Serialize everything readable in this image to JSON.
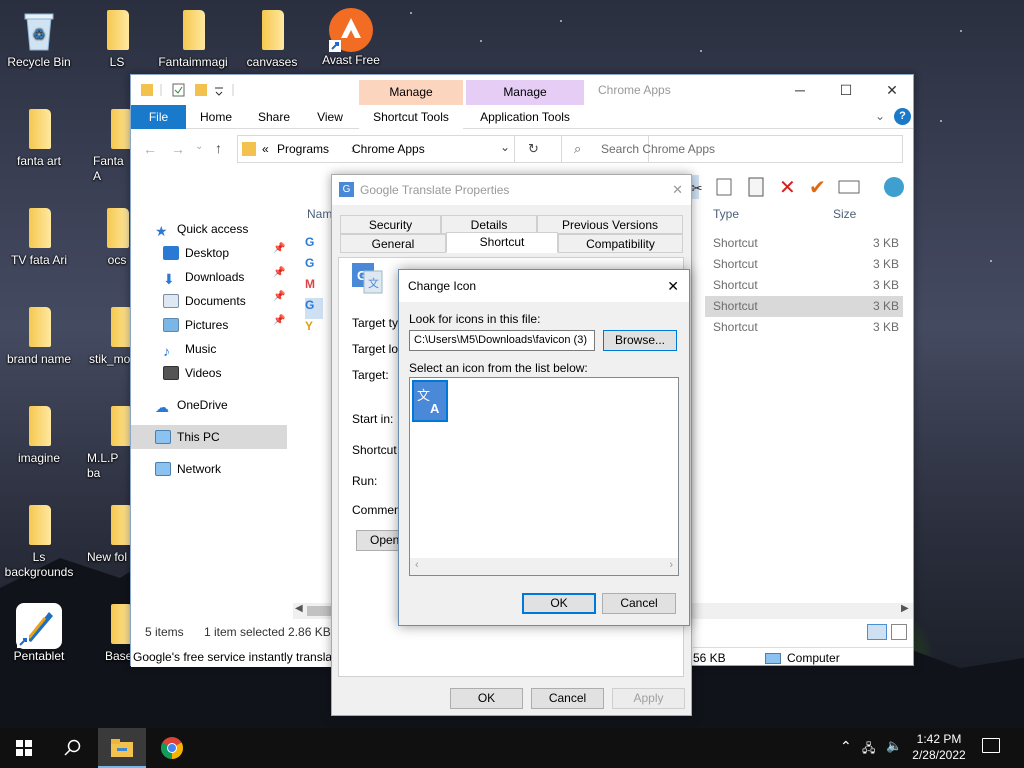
{
  "desktop": {
    "icons": [
      {
        "label": "Recycle Bin",
        "type": "recycle"
      },
      {
        "label": "LS",
        "type": "folder"
      },
      {
        "label": "Fantaimmagi",
        "type": "folder"
      },
      {
        "label": "canvases",
        "type": "folder"
      },
      {
        "label": "Avast Free",
        "type": "avast"
      },
      {
        "label": "fanta art",
        "type": "folder"
      },
      {
        "label": "Fanta A",
        "type": "folder"
      },
      {
        "label": "TV  fata Ari",
        "type": "folder"
      },
      {
        "label": "ocs",
        "type": "folder"
      },
      {
        "label": "brand name",
        "type": "folder"
      },
      {
        "label": "stik_mo",
        "type": "folder"
      },
      {
        "label": "imagine",
        "type": "folder"
      },
      {
        "label": "M.L.P ba",
        "type": "folder"
      },
      {
        "label": "Ls backgrounds",
        "type": "folder"
      },
      {
        "label": "New fol",
        "type": "folder"
      },
      {
        "label": "Pentablet",
        "type": "pentablet"
      },
      {
        "label": "Base",
        "type": "folder"
      }
    ]
  },
  "explorer": {
    "title": "Chrome Apps",
    "manage1": "Manage",
    "manage2": "Manage",
    "tabs": {
      "file": "File",
      "home": "Home",
      "share": "Share",
      "view": "View",
      "shortcut_tools": "Shortcut Tools",
      "application_tools": "Application Tools"
    },
    "address": {
      "sep": "«",
      "part1": "Programs",
      "part2": "Chrome Apps"
    },
    "search_placeholder": "Search Chrome Apps",
    "nav": {
      "quick_access": "Quick access",
      "desktop": "Desktop",
      "downloads": "Downloads",
      "documents": "Documents",
      "pictures": "Pictures",
      "music": "Music",
      "videos": "Videos",
      "onedrive": "OneDrive",
      "this_pc": "This PC",
      "network": "Network"
    },
    "columns": {
      "name": "Nam",
      "type": "Type",
      "size": "Size"
    },
    "rows": [
      {
        "type": "Shortcut",
        "size": "3 KB"
      },
      {
        "type": "Shortcut",
        "size": "3 KB"
      },
      {
        "type": "Shortcut",
        "size": "3 KB"
      },
      {
        "type": "Shortcut",
        "size": "3 KB"
      },
      {
        "type": "Shortcut",
        "size": "3 KB"
      }
    ],
    "status": {
      "items": "5 items",
      "selected": "1 item selected  2.86 KB",
      "tooltip": "Google's free service instantly translat",
      "right_size": "56 KB",
      "computer": "Computer"
    }
  },
  "props": {
    "title": "Google Translate Properties",
    "tabs": {
      "security": "Security",
      "details": "Details",
      "previous": "Previous Versions",
      "general": "General",
      "shortcut": "Shortcut",
      "compat": "Compatibility"
    },
    "labels": {
      "target_type": "Target typ",
      "target_loc": "Target loc",
      "target": "Target:",
      "start_in": "Start in:",
      "shortcut_key": "Shortcut k",
      "run": "Run:",
      "comment": "Comment:",
      "open": "Open"
    },
    "buttons": {
      "ok": "OK",
      "cancel": "Cancel",
      "apply": "Apply"
    }
  },
  "change_icon": {
    "title": "Change Icon",
    "look_label": "Look for icons in this file:",
    "path": "C:\\Users\\M5\\Downloads\\favicon (3)",
    "browse": "Browse...",
    "select_label": "Select an icon from the list below:",
    "ok": "OK",
    "cancel": "Cancel"
  },
  "taskbar": {
    "time": "1:42 PM",
    "date": "2/28/2022"
  },
  "colors": {
    "accent": "#0078d7",
    "manage1": "#fcd5bf",
    "manage2": "#e5cdf5"
  }
}
